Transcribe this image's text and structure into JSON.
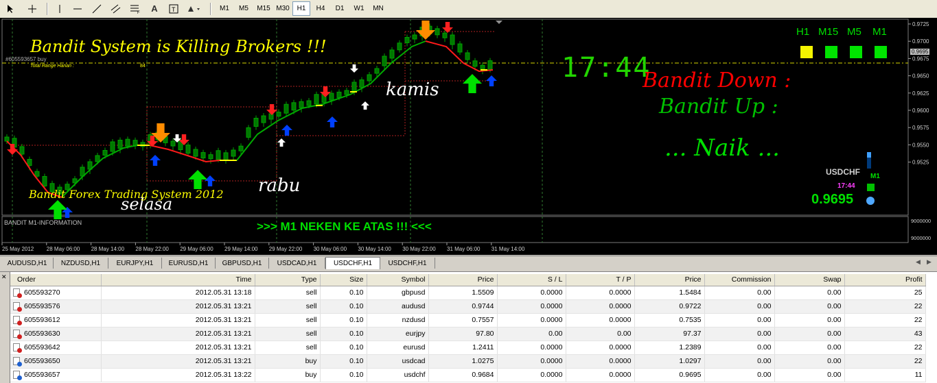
{
  "toolbar": {
    "tools": [
      "cursor-icon",
      "crosshair-icon",
      "vertical-line-icon",
      "horizontal-line-icon",
      "trendline-icon",
      "equidistant-channel-icon",
      "fibonacci-icon",
      "text-icon",
      "text-label-icon",
      "arrows-icon"
    ],
    "text_tool_label": "A",
    "timeframes": [
      "M1",
      "M5",
      "M15",
      "M30",
      "H1",
      "H4",
      "D1",
      "W1",
      "MN"
    ],
    "active_timeframe": "H1"
  },
  "chart": {
    "symbol": "USDCHF",
    "headline": "Bandit System  is Killing Brokers !!!",
    "order_line_label": "#605593657 buy",
    "total_range_label": "Total Range Harian :",
    "total_range_value": "84",
    "clock": "17:44",
    "signal_down": "Bandit Down :",
    "signal_up": "Bandit Up :",
    "signal_status": "... Naik ...",
    "tf_labels": [
      "H1",
      "M15",
      "M5",
      "M1"
    ],
    "tf_colors": [
      "#f4f400",
      "#00e400",
      "#00e400",
      "#00e400"
    ],
    "day_labels": {
      "selasa": "selasa",
      "rabu": "rabu",
      "kamis": "kamis"
    },
    "footer_text": "Bandit Forex Trading System 2012",
    "widget_symbol": "USDCHF",
    "widget_tf": "M1",
    "widget_time": "17:44",
    "widget_price": "0.9695",
    "bid_price": "0.9695",
    "price_axis": [
      "0.9725",
      "0.9700",
      "0.9675",
      "0.9650",
      "0.9625",
      "0.9600",
      "0.9575",
      "0.9550",
      "0.9525"
    ],
    "time_axis": [
      "25 May 2012",
      "28 May 06:00",
      "28 May 14:00",
      "28 May 22:00",
      "29 May 06:00",
      "29 May 14:00",
      "29 May 22:00",
      "30 May 06:00",
      "30 May 14:00",
      "30 May 22:00",
      "31 May 06:00",
      "31 May 14:00"
    ],
    "subwindow_title": "BANDIT M1-INFORMATION",
    "subwindow_message": ">>> M1 NEKEN KE ATAS !!! <<<",
    "subwindow_axis": [
      "9000000",
      "9000000"
    ],
    "colors": {
      "up_line": "#00aa00",
      "down_line": "#ff1a1a",
      "neutral_line": "#ffff00",
      "grid": "#3c6e3c",
      "text_yellow": "#ffff00",
      "text_green": "#00e000",
      "text_red": "#ff0000"
    }
  },
  "tabs": {
    "items": [
      "AUDUSD,H1",
      "NZDUSD,H1",
      "EURJPY,H1",
      "EURUSD,H1",
      "GBPUSD,H1",
      "USDCAD,H1",
      "USDCHF,H1",
      "USDCHF,H1"
    ],
    "active_index": 6
  },
  "terminal": {
    "columns": [
      "Order",
      "Time",
      "Type",
      "Size",
      "Symbol",
      "Price",
      "S / L",
      "T / P",
      "Price",
      "Commission",
      "Swap",
      "Profit"
    ],
    "rows": [
      {
        "order": "605593270",
        "time": "2012.05.31 13:18",
        "type": "sell",
        "size": "0.10",
        "symbol": "gbpusd",
        "price": "1.5509",
        "sl": "0.0000",
        "tp": "0.0000",
        "cur": "1.5484",
        "commission": "0.00",
        "swap": "0.00",
        "profit": "25"
      },
      {
        "order": "605593576",
        "time": "2012.05.31 13:21",
        "type": "sell",
        "size": "0.10",
        "symbol": "audusd",
        "price": "0.9744",
        "sl": "0.0000",
        "tp": "0.0000",
        "cur": "0.9722",
        "commission": "0.00",
        "swap": "0.00",
        "profit": "22"
      },
      {
        "order": "605593612",
        "time": "2012.05.31 13:21",
        "type": "sell",
        "size": "0.10",
        "symbol": "nzdusd",
        "price": "0.7557",
        "sl": "0.0000",
        "tp": "0.0000",
        "cur": "0.7535",
        "commission": "0.00",
        "swap": "0.00",
        "profit": "22"
      },
      {
        "order": "605593630",
        "time": "2012.05.31 13:21",
        "type": "sell",
        "size": "0.10",
        "symbol": "eurjpy",
        "price": "97.80",
        "sl": "0.00",
        "tp": "0.00",
        "cur": "97.37",
        "commission": "0.00",
        "swap": "0.00",
        "profit": "43"
      },
      {
        "order": "605593642",
        "time": "2012.05.31 13:21",
        "type": "sell",
        "size": "0.10",
        "symbol": "eurusd",
        "price": "1.2411",
        "sl": "0.0000",
        "tp": "0.0000",
        "cur": "1.2389",
        "commission": "0.00",
        "swap": "0.00",
        "profit": "22"
      },
      {
        "order": "605593650",
        "time": "2012.05.31 13:21",
        "type": "buy",
        "size": "0.10",
        "symbol": "usdcad",
        "price": "1.0275",
        "sl": "0.0000",
        "tp": "0.0000",
        "cur": "1.0297",
        "commission": "0.00",
        "swap": "0.00",
        "profit": "22"
      },
      {
        "order": "605593657",
        "time": "2012.05.31 13:22",
        "type": "buy",
        "size": "0.10",
        "symbol": "usdchf",
        "price": "0.9684",
        "sl": "0.0000",
        "tp": "0.0000",
        "cur": "0.9695",
        "commission": "0.00",
        "swap": "0.00",
        "profit": "11"
      }
    ]
  }
}
